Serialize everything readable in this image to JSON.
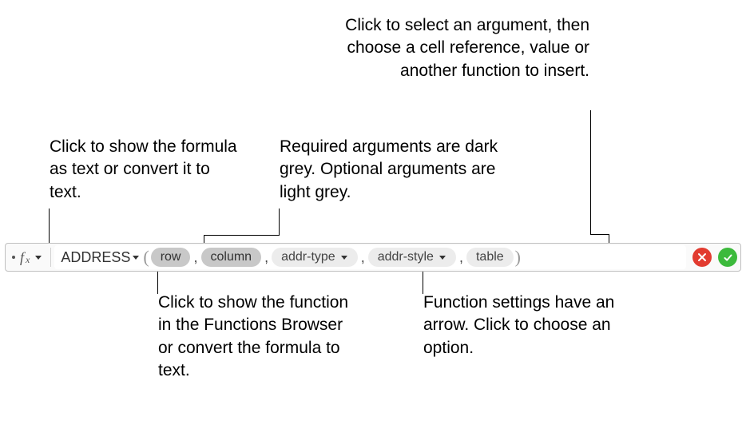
{
  "callouts": {
    "top_left": "Click to show the formula as text or convert it to text.",
    "top_mid": "Required arguments are dark grey. Optional arguments are light grey.",
    "top_right": "Click to select an argument, then choose a cell reference, value or another function to insert.",
    "bottom_left": "Click to show the function in the Functions Browser or convert the formula to text.",
    "bottom_right": "Function settings have an arrow. Click to choose an option."
  },
  "formula": {
    "fx_label_f": "f",
    "fx_label_x": "x",
    "function_name": "ADDRESS",
    "args": {
      "row": "row",
      "column": "column",
      "addr_type": "addr-type",
      "addr_style": "addr-style",
      "table": "table"
    },
    "separator": ","
  }
}
